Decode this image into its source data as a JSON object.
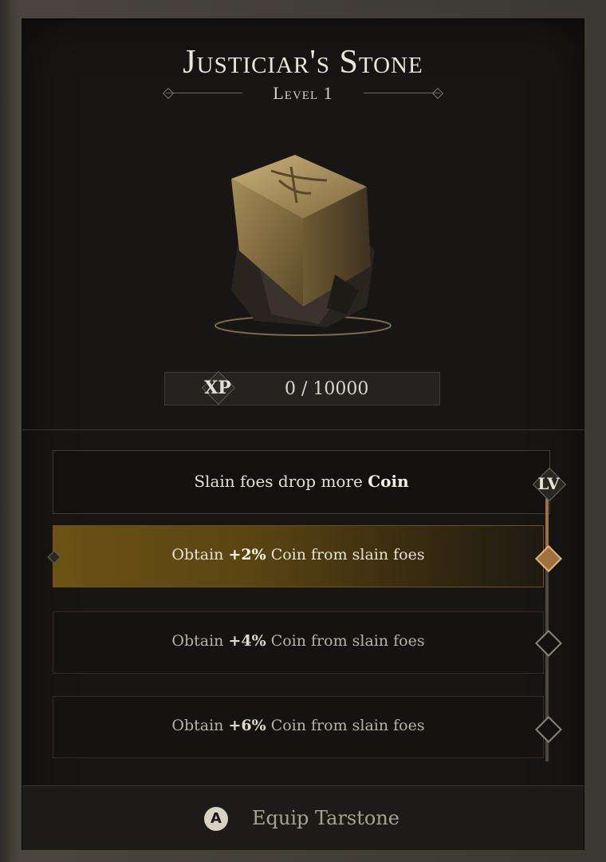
{
  "item": {
    "title": "Justiciar's Stone",
    "level_label": "Level 1",
    "icon": "tarstone-cube-icon"
  },
  "xp": {
    "label": "XP",
    "value": "0 / 10000"
  },
  "perk": {
    "prefix": "Slain foes drop more ",
    "highlight": "Coin",
    "lv_badge": "LV"
  },
  "tiers": [
    {
      "prefix": "Obtain ",
      "bold": "+2%",
      "suffix": " Coin from slain foes",
      "active": true
    },
    {
      "prefix": "Obtain ",
      "bold": "+4%",
      "suffix": " Coin from slain foes",
      "active": false
    },
    {
      "prefix": "Obtain ",
      "bold": "+6%",
      "suffix": " Coin from slain foes",
      "active": false
    }
  ],
  "footer": {
    "button_glyph": "A",
    "action_label": "Equip Tarstone"
  },
  "colors": {
    "accent": "#a0703e",
    "active_row": "#6b5214"
  }
}
